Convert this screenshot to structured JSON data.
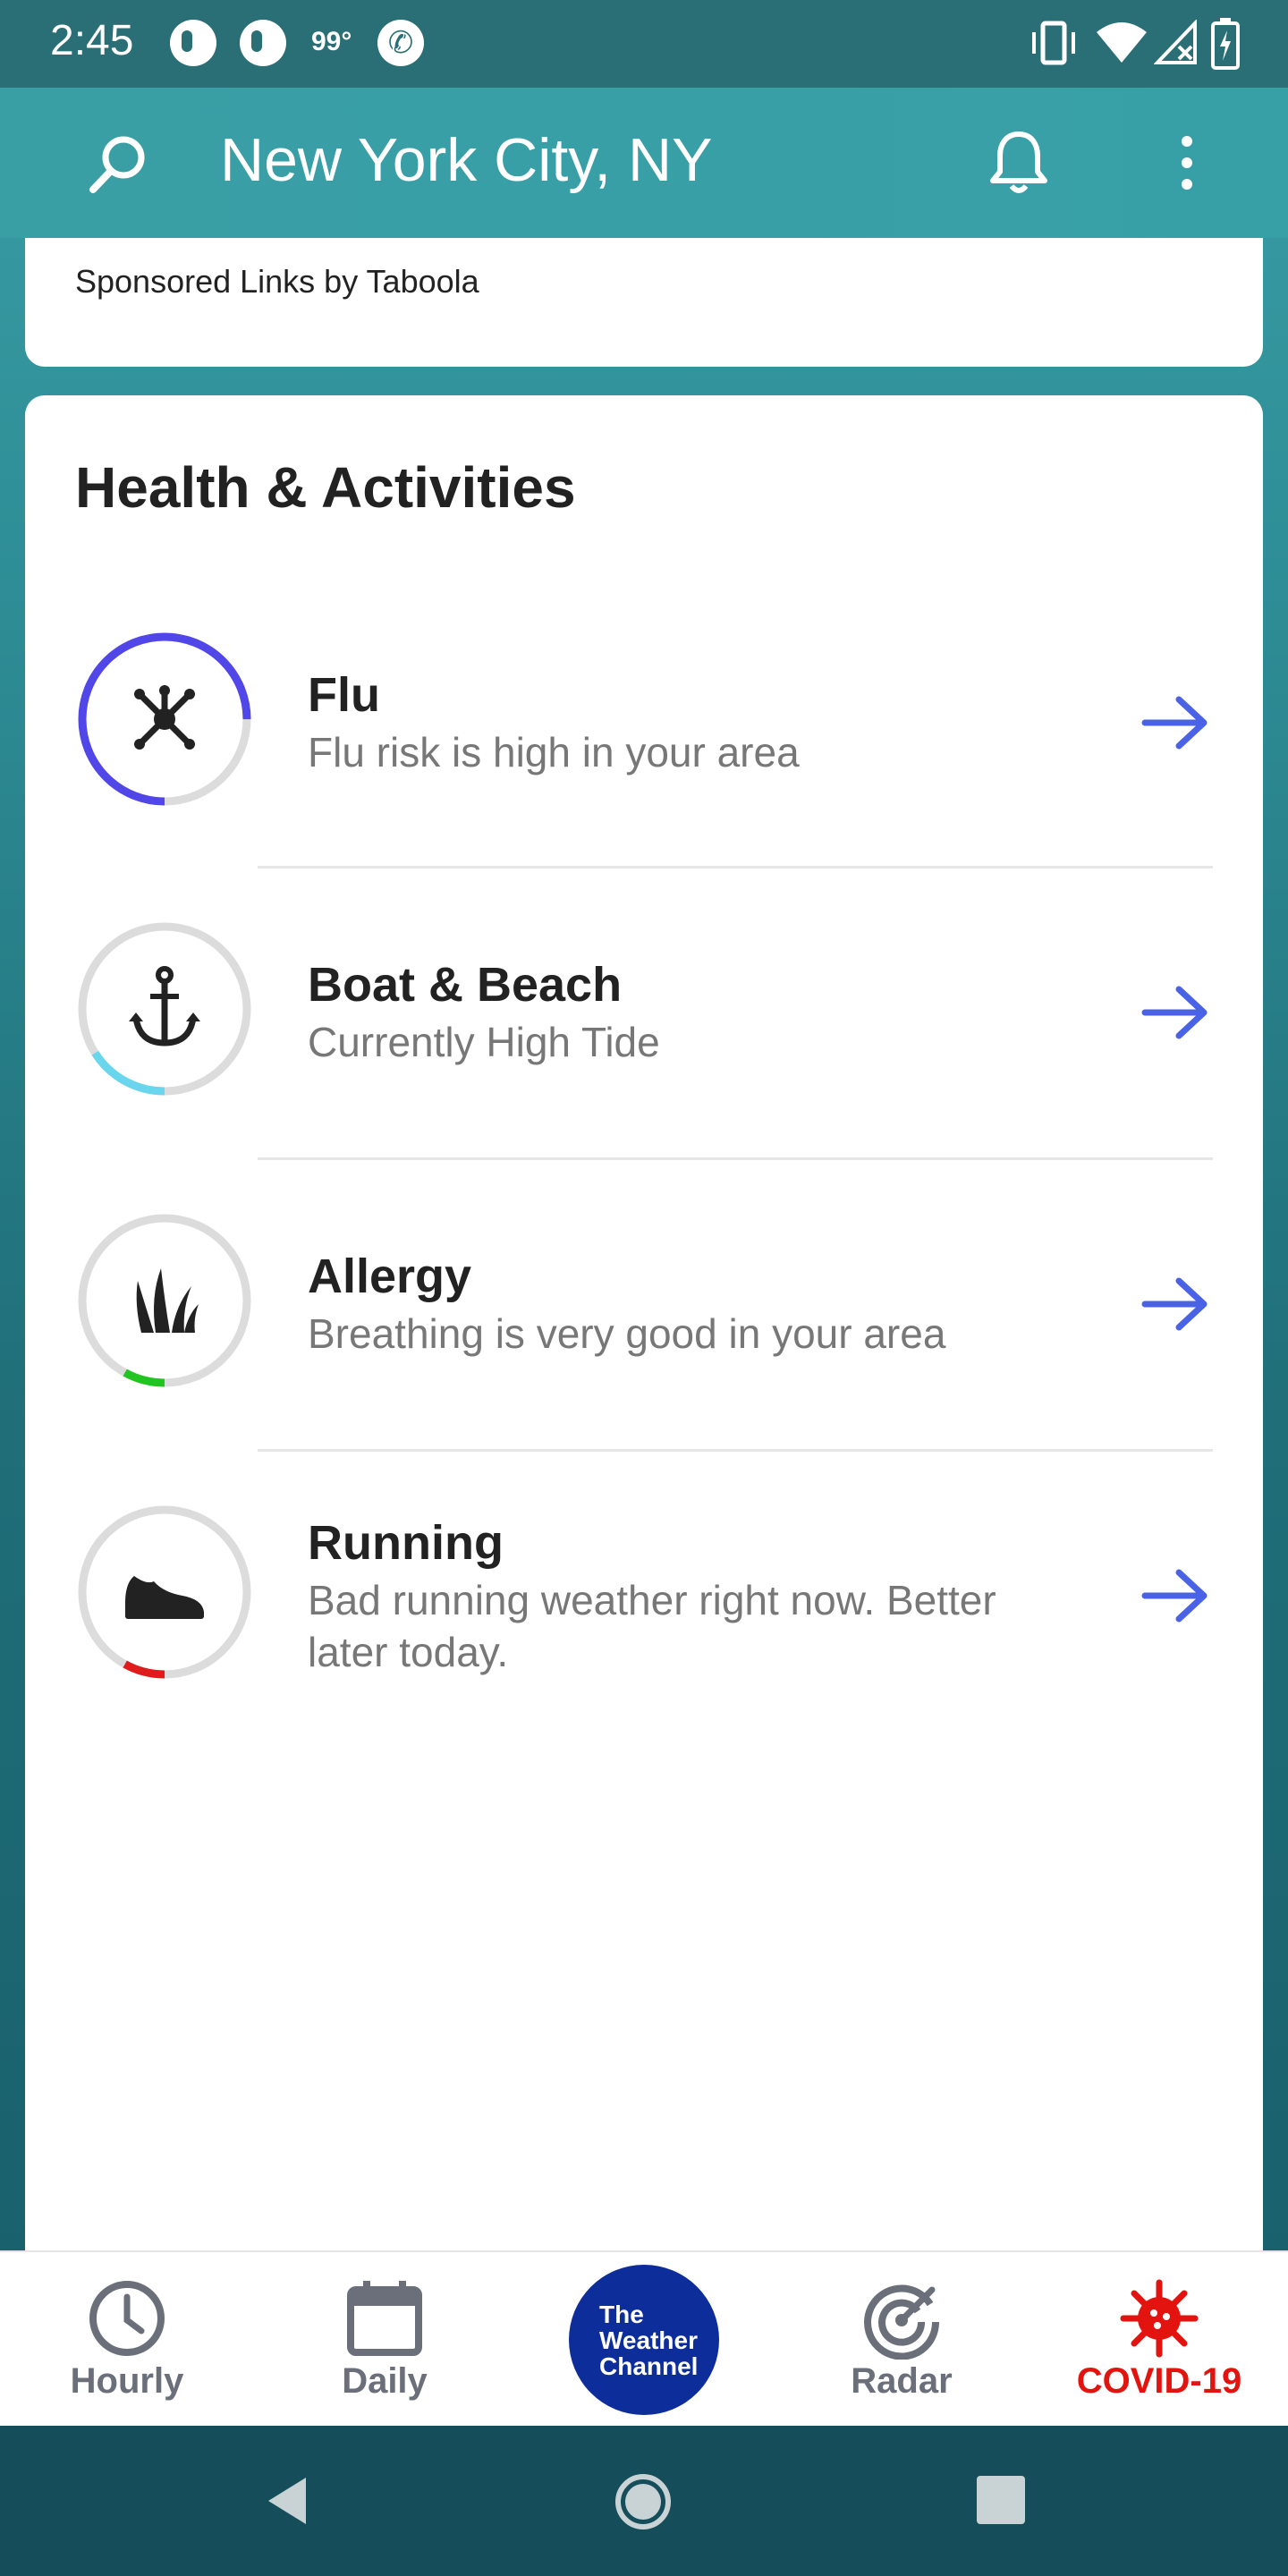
{
  "status_bar": {
    "time": "2:45",
    "temperature": "99°",
    "icons": [
      "notification-icon",
      "notification-icon",
      "phone-icon",
      "vibrate-icon",
      "wifi-icon",
      "signal-icon",
      "battery-charging-icon"
    ]
  },
  "app_bar": {
    "location": "New York City, NY",
    "icons": [
      "search-icon",
      "bell-icon",
      "more-vert-icon"
    ]
  },
  "sponsored": {
    "text": "Sponsored Links by Taboola"
  },
  "health": {
    "title": "Health & Activities",
    "items": [
      {
        "name": "Flu",
        "description": "Flu risk is high in your area",
        "icon": "virus-icon",
        "level": 0.75,
        "color": "#5146e8"
      },
      {
        "name": "Boat & Beach",
        "description": "Currently High Tide",
        "icon": "anchor-icon",
        "level": 0.16,
        "color": "#6ad6ee"
      },
      {
        "name": "Allergy",
        "description": "Breathing is very good in your area",
        "icon": "grass-icon",
        "level": 0.08,
        "color": "#22c422"
      },
      {
        "name": "Running",
        "description": "Bad running weather right now. Better later today.",
        "icon": "shoe-icon",
        "level": 0.08,
        "color": "#e01b1b"
      }
    ]
  },
  "bottom_nav": {
    "items": [
      {
        "label": "Hourly",
        "icon": "clock-icon"
      },
      {
        "label": "Daily",
        "icon": "calendar-icon"
      },
      {
        "label": "Radar",
        "icon": "radar-icon"
      },
      {
        "label": "COVID-19",
        "icon": "virus-icon"
      }
    ],
    "logo": {
      "line1": "The",
      "line2": "Weather",
      "line3": "Channel"
    }
  },
  "colors": {
    "accent": "#3a9ea5",
    "arrow": "#4a63e6",
    "logo": "#0d2e9a",
    "covid": "#e3140f"
  }
}
